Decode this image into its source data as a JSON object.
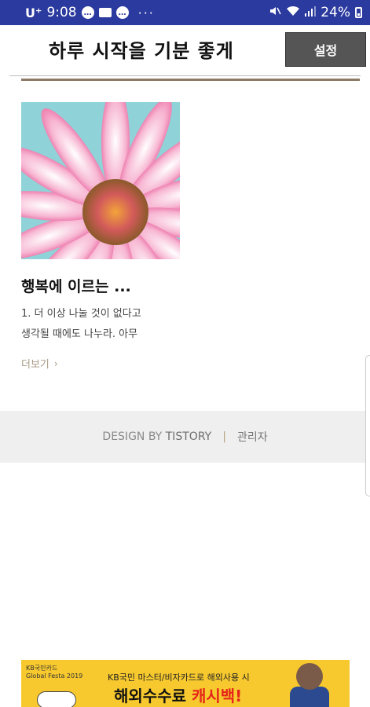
{
  "status_bar": {
    "carrier": "U⁺",
    "time": "9:08",
    "more": "···",
    "battery": "24%"
  },
  "header": {
    "title": "하루 시작을 기분 좋게",
    "settings_label": "설정"
  },
  "post": {
    "title": "행복에 이르는 ...",
    "excerpt": "1. 더 이상 나눌 것이 없다고\n생각될 때에도 나누라. 아무",
    "more_label": "더보기",
    "image": "pink-daisy-flower"
  },
  "footer": {
    "design_by": "DESIGN BY",
    "brand": "TISTORY",
    "separator": "|",
    "admin": "관리자"
  },
  "ad": {
    "brand_line1": "KB국민카드",
    "brand_line2": "Global Festa 2019",
    "line1": "KB국민 마스터/비자카드로 해외사용 시",
    "line2_prefix": "해외수수료 ",
    "line2_highlight": "캐시백!"
  },
  "colors": {
    "status_bar": "#2b3a9e",
    "settings_button": "#555555",
    "accent_rule": "#8c7a66",
    "more_link": "#a89a86",
    "footer_bg": "#efefef",
    "ad_bg": "#f7c92e",
    "ad_highlight": "#e5251b"
  }
}
